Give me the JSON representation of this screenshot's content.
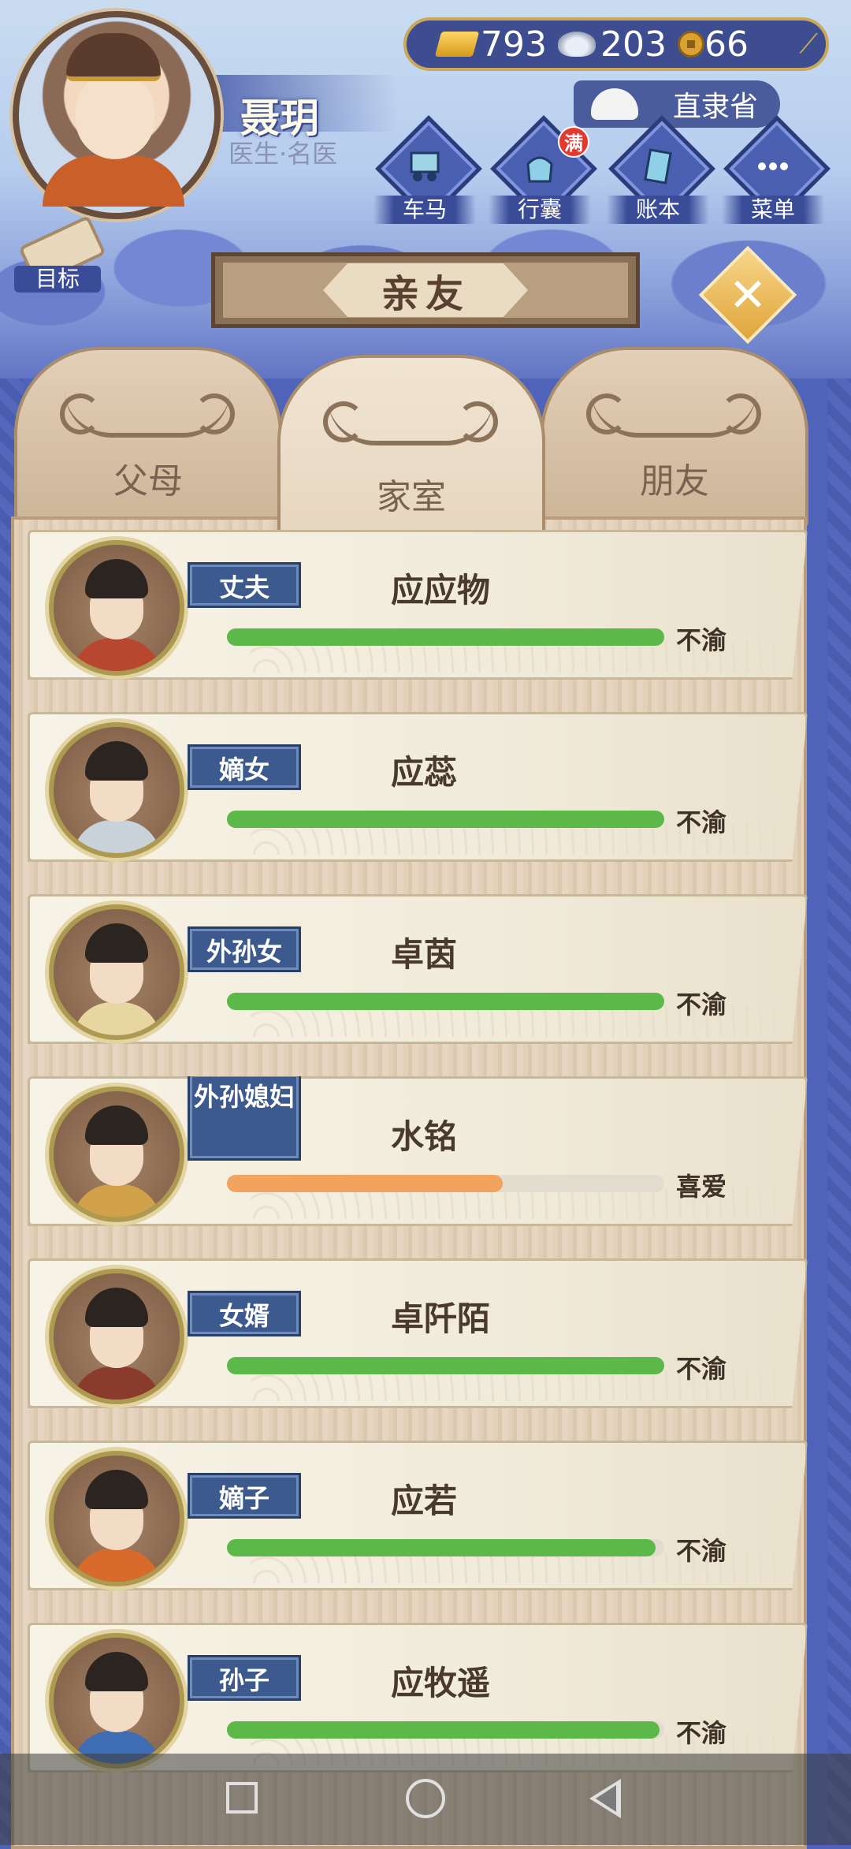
{
  "player": {
    "name": "聂玥",
    "title": "医生·名医"
  },
  "currency": {
    "gold": "793",
    "silver": "203",
    "coins": "66"
  },
  "province": "直隶省",
  "nav_buttons": [
    {
      "label": "车马",
      "icon": "carriage-icon"
    },
    {
      "label": "行囊",
      "icon": "bag-icon",
      "badge": "满"
    },
    {
      "label": "账本",
      "icon": "ledger-icon"
    },
    {
      "label": "菜单",
      "icon": "menu-dots-icon"
    }
  ],
  "goal_label": "目标",
  "panel_title": "亲友",
  "tabs": [
    {
      "label": "父母",
      "active": false
    },
    {
      "label": "家室",
      "active": true
    },
    {
      "label": "朋友",
      "active": false
    }
  ],
  "relatives": [
    {
      "role": "丈夫",
      "name": "应应物",
      "mood": "不渝",
      "affection": 1.0,
      "bar_color": "#5db84a"
    },
    {
      "role": "嫡女",
      "name": "应蕊",
      "mood": "不渝",
      "affection": 1.0,
      "bar_color": "#5db84a"
    },
    {
      "role": "外孙女",
      "name": "卓茵",
      "mood": "不渝",
      "affection": 1.0,
      "bar_color": "#5db84a"
    },
    {
      "role": "外孙媳妇",
      "name": "水铭",
      "mood": "喜爱",
      "affection": 0.63,
      "bar_color": "#f2a45e"
    },
    {
      "role": "女婿",
      "name": "卓阡陌",
      "mood": "不渝",
      "affection": 1.0,
      "bar_color": "#5db84a"
    },
    {
      "role": "嫡子",
      "name": "应若",
      "mood": "不渝",
      "affection": 0.98,
      "bar_color": "#5db84a"
    },
    {
      "role": "孙子",
      "name": "应牧遥",
      "mood": "不渝",
      "affection": 0.99,
      "bar_color": "#5db84a"
    }
  ]
}
